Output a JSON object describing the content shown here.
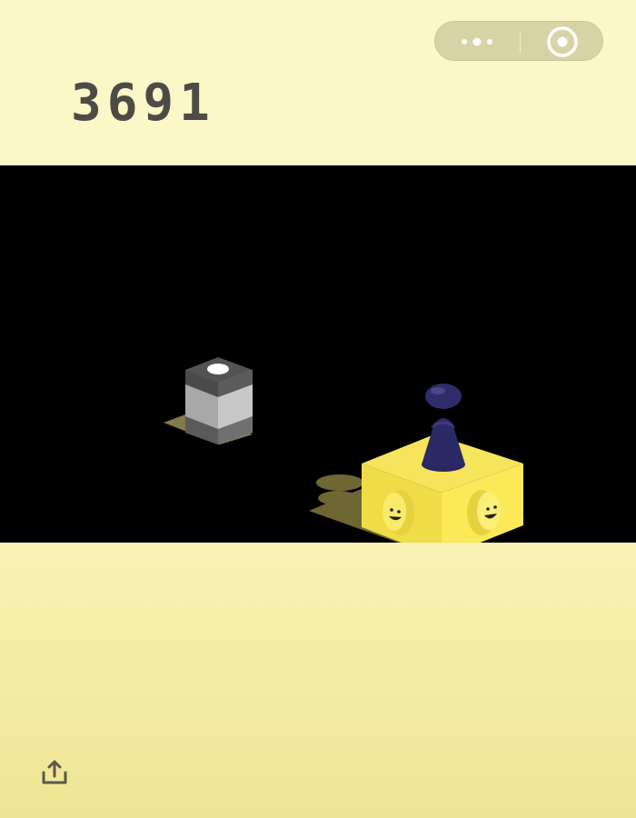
{
  "score": "3691",
  "capsule": {
    "more_icon": "more-dots-icon",
    "close_icon": "target-close-icon"
  },
  "share": {
    "icon": "share-icon"
  },
  "colors": {
    "background_top": "#fbf7c6",
    "background_bottom": "#efe594",
    "stage": "#000000",
    "score_text": "#4d4b45",
    "cube_yellow": "#f3e24d",
    "gray_box": "#6a6a6a",
    "piece": "#262363"
  }
}
